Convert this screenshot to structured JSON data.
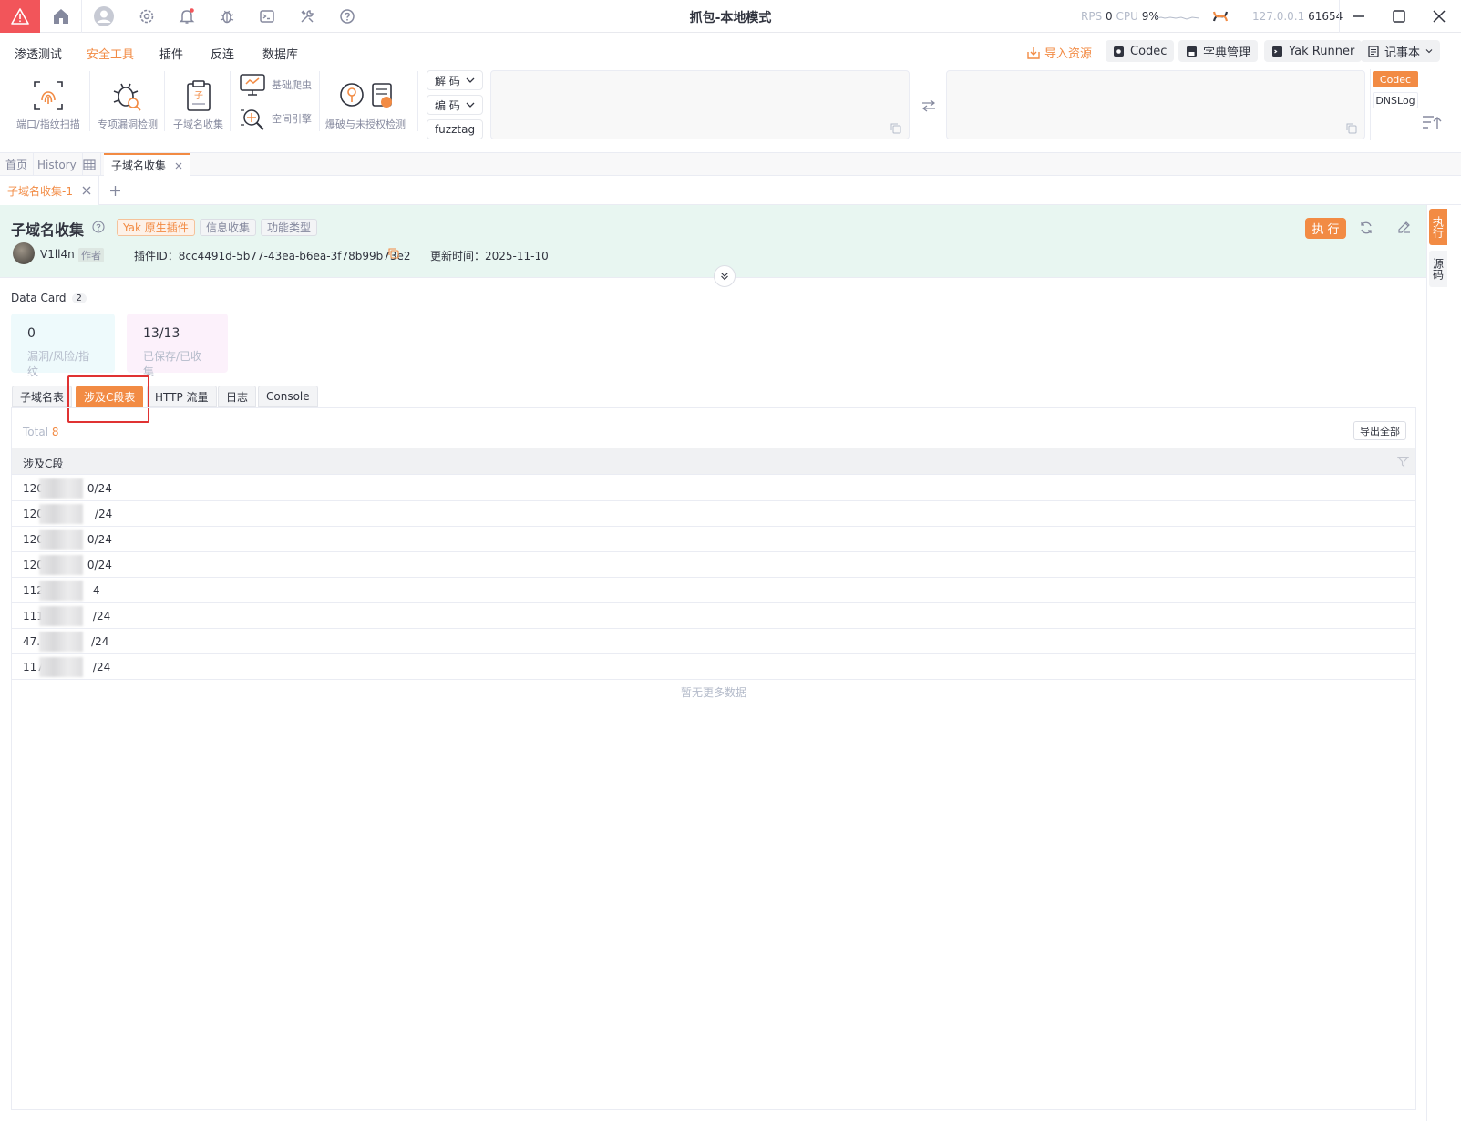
{
  "app": {
    "title": "抓包-本地模式",
    "rps_label": "RPS",
    "rps_value": "0",
    "cpu_label": "CPU",
    "cpu_value": "9%",
    "host": "127.0.0.1",
    "port": "61654"
  },
  "menu": {
    "items": [
      "渗透测试",
      "安全工具",
      "插件",
      "反连",
      "数据库"
    ],
    "active_index": 1,
    "import_label": "导入资源",
    "buttons": [
      "Codec",
      "字典管理",
      "Yak Runner",
      "记事本"
    ]
  },
  "tools": {
    "port_scan": "端口/指纹扫描",
    "vuln_check": "专项漏洞检测",
    "subdomain": "子域名收集",
    "crawler": "基础爬虫",
    "space_engine": "空间引擎",
    "brute": "爆破与未授权检测",
    "decode": "解 码",
    "encode": "编 码",
    "fuzztag": "fuzztag",
    "codec_tab": "Codec",
    "dnslog_tab": "DNSLog"
  },
  "page_tabs": [
    "首页",
    "History",
    "子域名收集"
  ],
  "sub_tab": "子域名收集-1",
  "plugin": {
    "name": "子域名收集",
    "tags": [
      "Yak 原生插件",
      "信息收集",
      "功能类型"
    ],
    "author": "V1ll4n",
    "author_role": "作者",
    "plugin_id_label": "插件ID：",
    "plugin_id": "8cc4491d-5b77-43ea-b6ea-3f78b99b73e2",
    "update_label": "更新时间：",
    "update_time": "2025-11-10",
    "exec_label": "执行"
  },
  "side": {
    "exec": "执行",
    "source": "源码"
  },
  "data_card": {
    "title": "Data Card",
    "count": "2",
    "cards": [
      {
        "value": "0",
        "label": "漏洞/风险/指纹",
        "color": "#eefafc"
      },
      {
        "value": "13/13",
        "label": "已保存/已收集",
        "color": "#fcf1fb"
      }
    ]
  },
  "result_tabs": [
    "子域名表",
    "涉及C段表",
    "HTTP 流量",
    "日志",
    "Console"
  ],
  "result_tab_active": 1,
  "table": {
    "total_label": "Total",
    "total": "8",
    "export_label": "导出全部",
    "column": "涉及C段",
    "rows": [
      {
        "prefix": "120",
        "suffix": "0/24"
      },
      {
        "prefix": "120",
        "suffix": "/24"
      },
      {
        "prefix": "120",
        "suffix": "0/24"
      },
      {
        "prefix": "120",
        "suffix": "0/24"
      },
      {
        "prefix": "112",
        "suffix": "4"
      },
      {
        "prefix": "111",
        "suffix": "/24"
      },
      {
        "prefix": "47.",
        "suffix": "/24"
      },
      {
        "prefix": "117",
        "suffix": "/24"
      }
    ],
    "no_more": "暂无更多数据"
  },
  "colors": {
    "accent": "#f28b44",
    "danger": "#f2555a",
    "header_bg": "#e8f6f1"
  }
}
